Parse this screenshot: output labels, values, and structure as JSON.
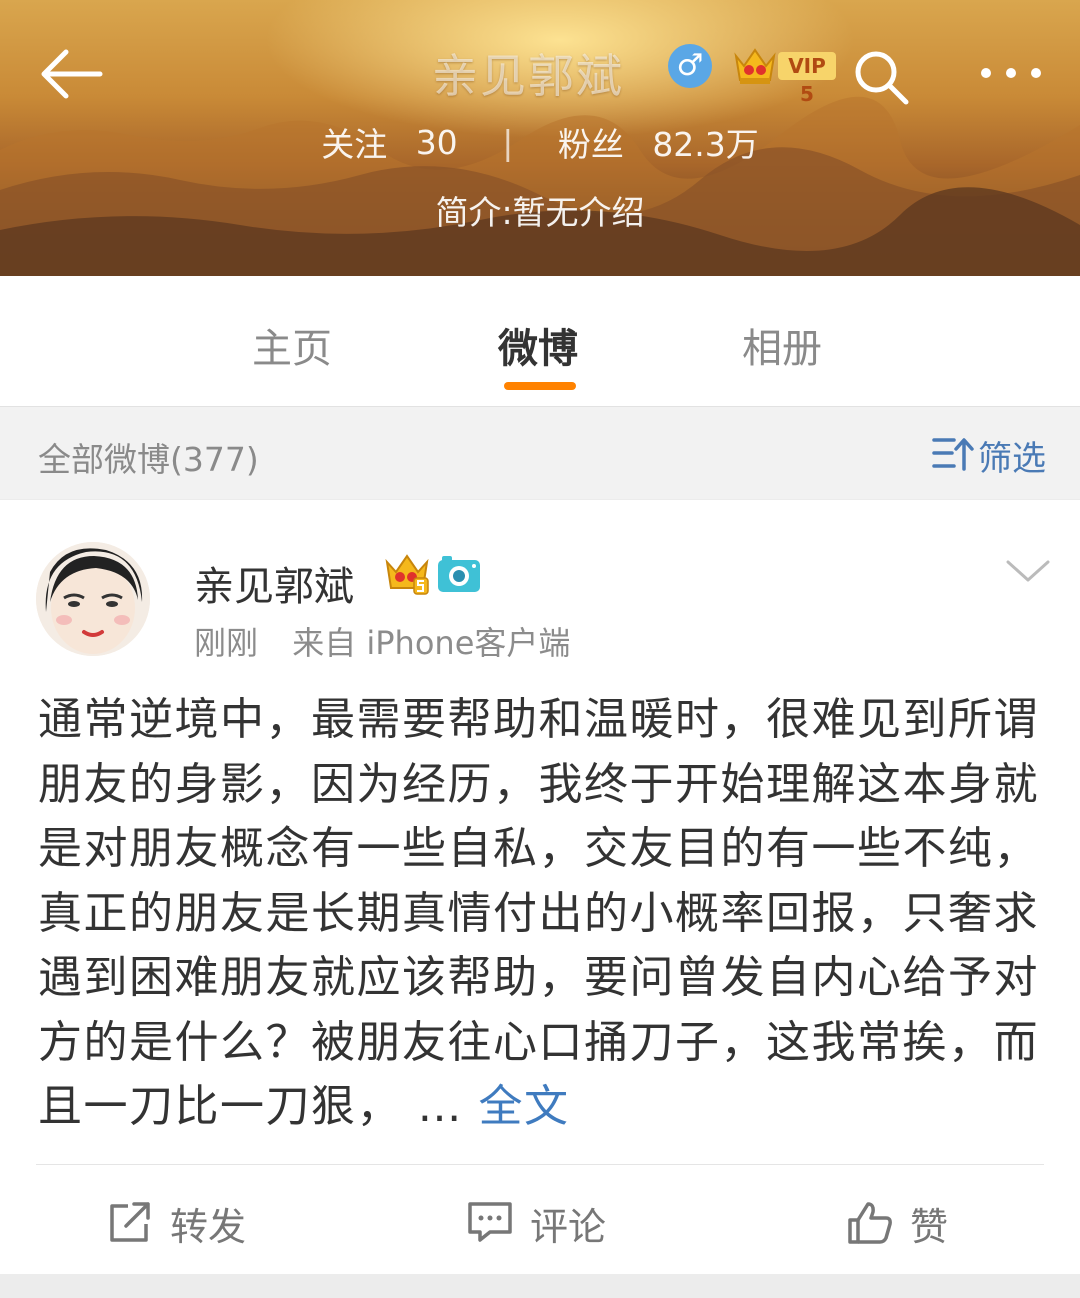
{
  "header": {
    "title": "亲见郭斌",
    "gender_symbol": "♂",
    "vip_label": "VIP 5",
    "following_label": "关注",
    "following_count": "30",
    "separator": "|",
    "followers_label": "粉丝",
    "followers_count": "82.3万",
    "bio": "简介:暂无介绍"
  },
  "tabs": [
    {
      "label": "主页",
      "active": false
    },
    {
      "label": "微博",
      "active": true
    },
    {
      "label": "相册",
      "active": false
    }
  ],
  "filter": {
    "count_label": "全部微博(377)",
    "filter_label": "筛选"
  },
  "post": {
    "author": "亲见郭斌",
    "time": "刚刚",
    "source": "来自 iPhone客户端",
    "text": "通常逆境中，最需要帮助和温暖时，很难见到所谓朋友的身影，因为经历，我终于开始理解这本身就是对朋友概念有一些自私，交友目的有一些不纯，真正的朋友是长期真情付出的小概率回报，只奢求遇到困难朋友就应该帮助，要问曾发自内心给予对方的是什么？被朋友往心口捅刀子，这我常挨，而且一刀比一刀狠，",
    "ellipsis": " …",
    "full_text_link": "全文"
  },
  "actions": {
    "repost": "转发",
    "comment": "评论",
    "like": "赞"
  },
  "colors": {
    "accent": "#ff8200",
    "link": "#3f7bbf",
    "vip_gold": "#f7d46a"
  }
}
